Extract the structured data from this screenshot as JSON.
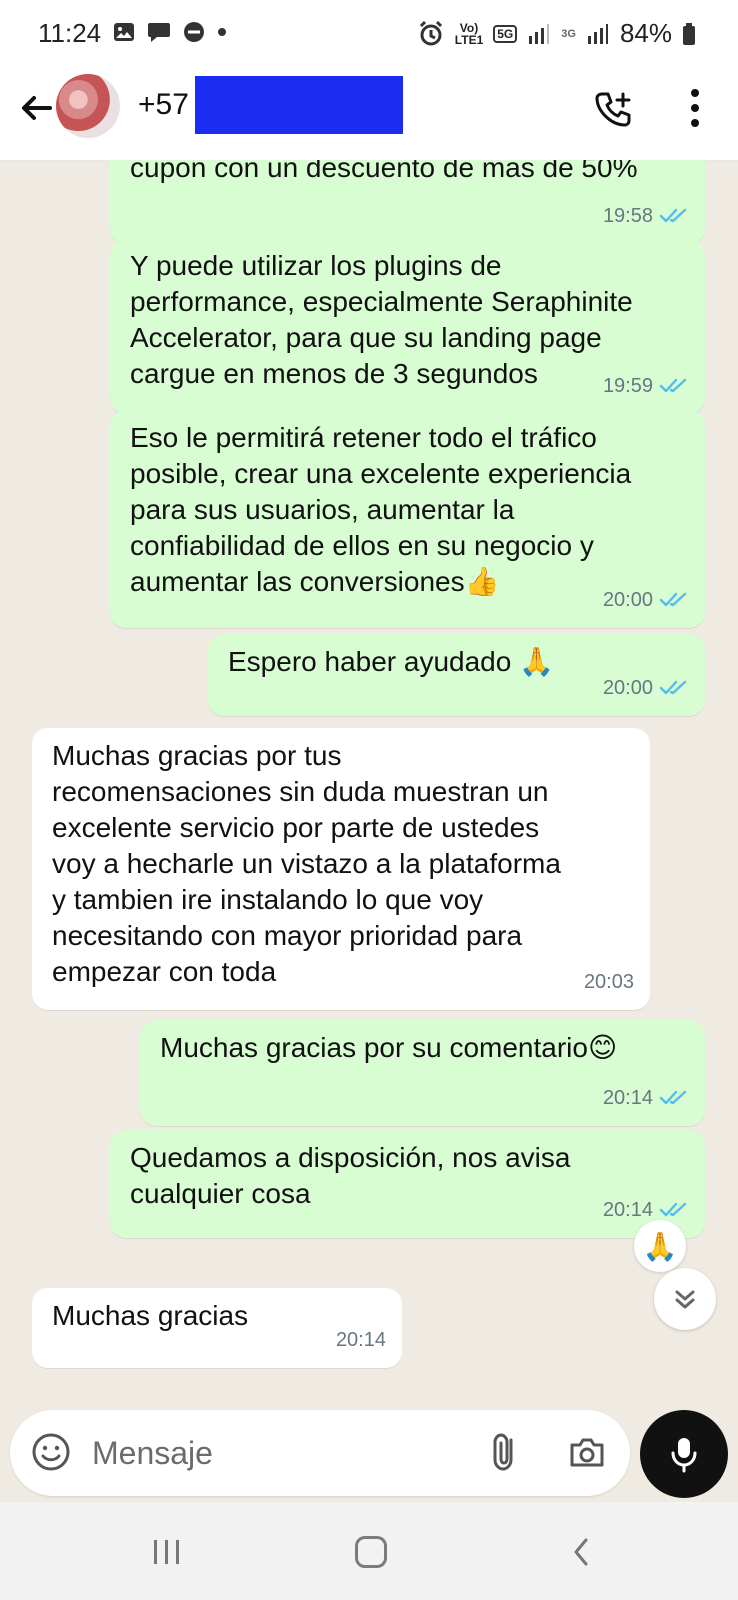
{
  "status_bar": {
    "time": "11:24",
    "network_top": "Vo)",
    "network_bottom": "LTE1",
    "five_g": "5G",
    "three_g": "3G",
    "battery": "84%"
  },
  "header": {
    "contact_prefix": "+57"
  },
  "messages": [
    {
      "direction": "outgoing",
      "text": "cupon con un descuento de mas de 50%",
      "time": "19:58"
    },
    {
      "direction": "outgoing",
      "text": "Y puede utilizar los plugins de\nperformance, especialmente Seraphinite\nAccelerator, para que su landing page\ncargue en menos de 3 segundos",
      "time": "19:59"
    },
    {
      "direction": "outgoing",
      "text": "Eso le permitirá retener todo el tráfico\nposible, crear una excelente experiencia\npara sus usuarios, aumentar la\nconfiabilidad de ellos en su negocio y\naumentar las conversiones👍",
      "time": "20:00"
    },
    {
      "direction": "outgoing",
      "text": "Espero haber ayudado 🙏",
      "time": "20:00"
    },
    {
      "direction": "incoming",
      "text": "Muchas gracias por tus\nrecomensaciones sin duda muestran un\nexcelente servicio por parte de ustedes\nvoy a hecharle un vistazo a la plataforma\ny tambien ire instalando lo que voy\nnecesitando con mayor prioridad para\nempezar con toda",
      "time": "20:03"
    },
    {
      "direction": "outgoing",
      "text": "Muchas gracias por su comentario😊",
      "time": "20:14"
    },
    {
      "direction": "outgoing",
      "text": "Quedamos a disposición, nos avisa\ncualquier cosa",
      "time": "20:14",
      "reaction": "🙏"
    },
    {
      "direction": "incoming",
      "text": "Muchas gracias",
      "time": "20:14"
    }
  ],
  "composer": {
    "placeholder": "Mensaje"
  },
  "colors": {
    "outgoing_bubble": "#d9fdd3",
    "incoming_bubble": "#ffffff",
    "read_ticks": "#53bdeb",
    "chat_background": "#efeae2"
  }
}
